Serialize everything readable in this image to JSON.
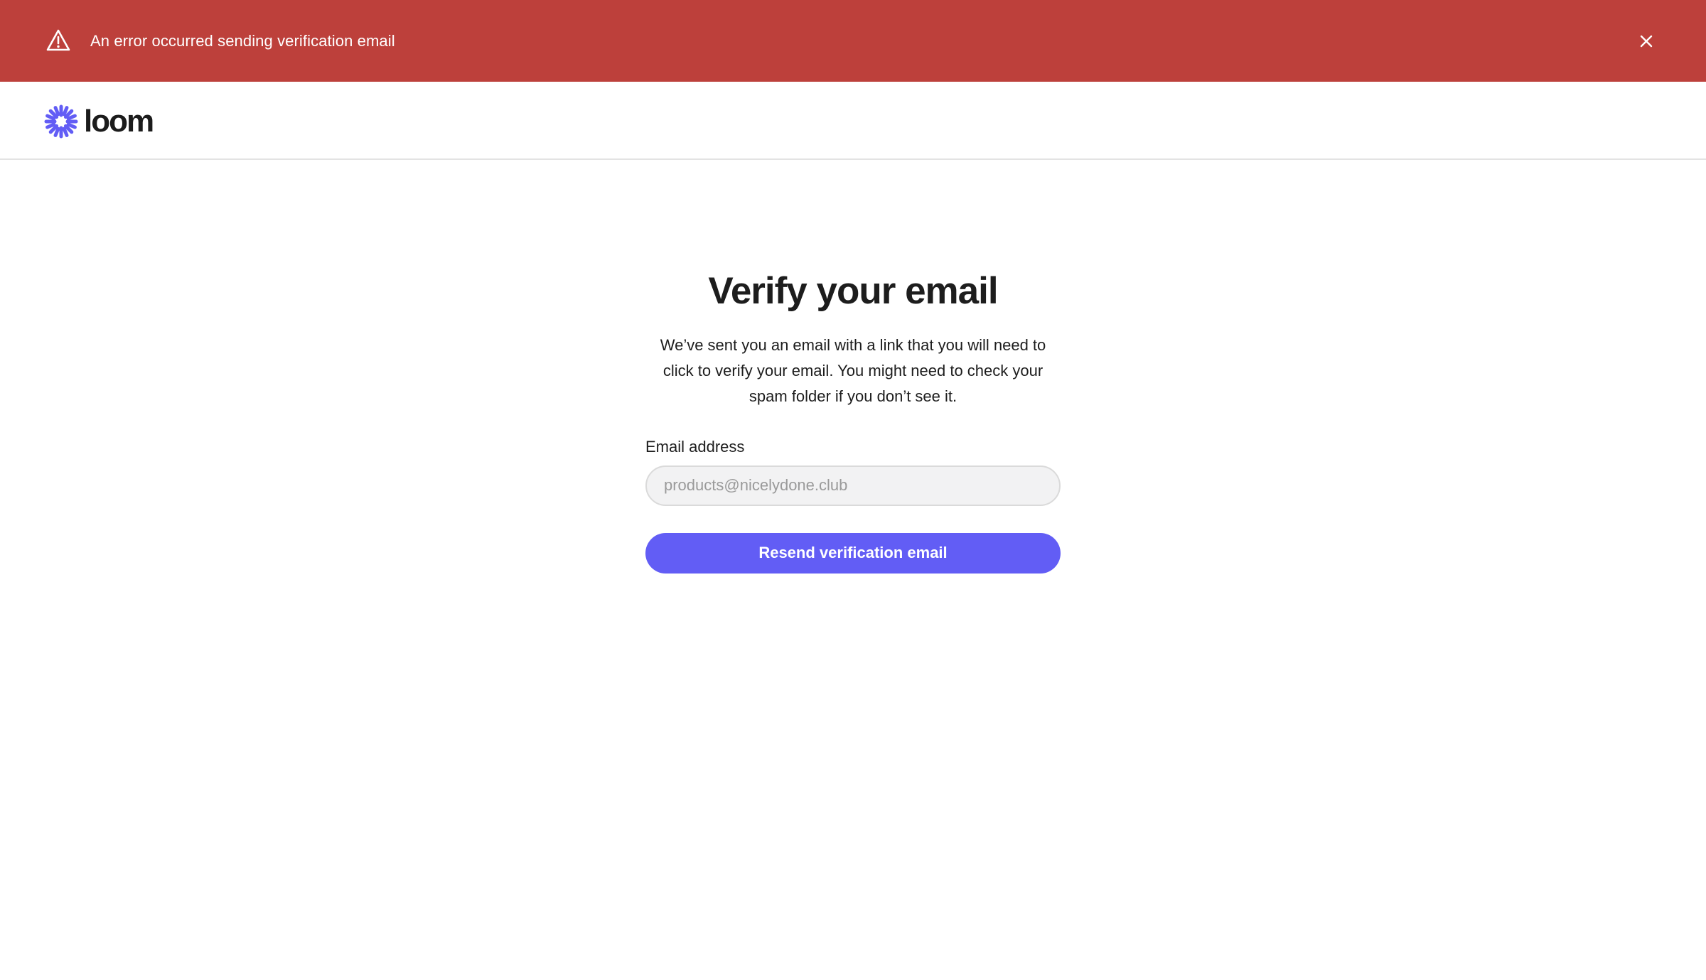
{
  "banner": {
    "message": "An error occurred sending verification email",
    "icon": "warning-triangle-icon",
    "close_icon": "close-icon",
    "color": "#bd403b"
  },
  "header": {
    "logo_text": "loom",
    "logo_icon": "loom-starburst-icon",
    "brand_color": "#625df5"
  },
  "main": {
    "title": "Verify your email",
    "description": "We’ve sent you an email with a link that you will need to click to verify your email. You might need to check your spam folder if you don’t see it.",
    "email_label": "Email address",
    "email_placeholder": "products@nicelydone.club",
    "email_value": "",
    "resend_label": "Resend verification email"
  }
}
